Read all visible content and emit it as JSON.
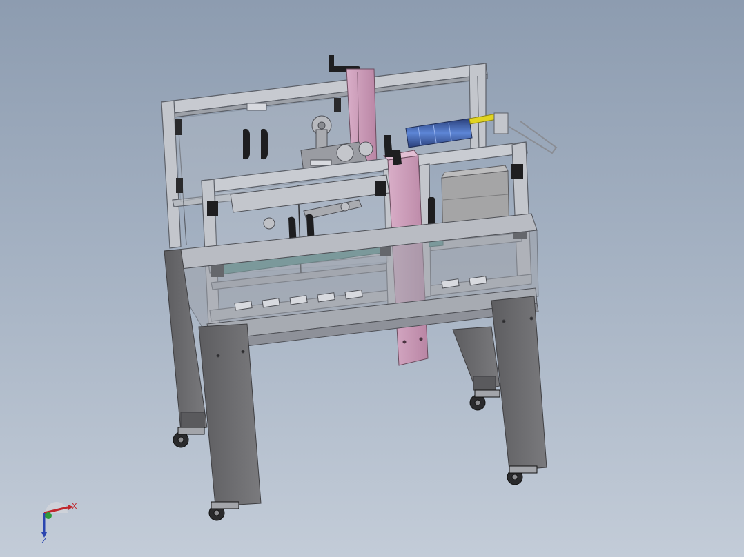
{
  "viewport": {
    "background_top": "#8d9cb0",
    "background_bottom": "#c3ccd8"
  },
  "model": {
    "box_label": "纸箱",
    "colors": {
      "frame_aluminum": "#c9ccd2",
      "frame_edge": "#5c6068",
      "leg_gray": "#6f6f72",
      "pink_column": "#c99ab6",
      "teal_belt": "#4f8e89",
      "blue_roller": "#3a5fa8",
      "yellow_rod": "#e1d421",
      "handle_black": "#1e1e20",
      "carton": "#a5a5a6"
    }
  },
  "triad": {
    "x_label": "X",
    "z_label": "Z",
    "x_color": "#c0272d",
    "y_color": "#2e9a3a",
    "z_color": "#2a45b0"
  }
}
